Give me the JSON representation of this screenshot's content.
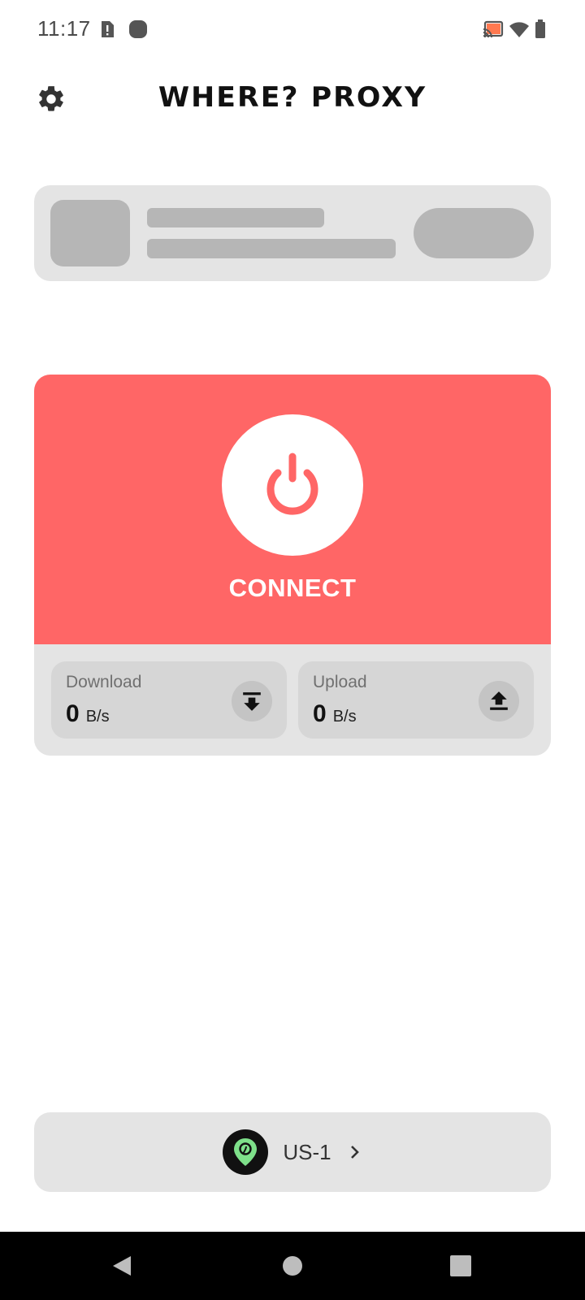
{
  "status_bar": {
    "time": "11:17",
    "icons": [
      "sim-alert-icon",
      "app-notification-icon",
      "cast-icon",
      "wifi-icon",
      "battery-icon"
    ]
  },
  "header": {
    "title": "WHERE? PROXY",
    "settings_icon": "gear-icon"
  },
  "connect_card": {
    "button_label": "CONNECT",
    "accent_color": "#ff6666",
    "download": {
      "label": "Download",
      "value": "0",
      "unit": "B/s",
      "icon": "download-icon"
    },
    "upload": {
      "label": "Upload",
      "value": "0",
      "unit": "B/s",
      "icon": "upload-icon"
    }
  },
  "server": {
    "name": "US-1",
    "icon": "location-pin-icon",
    "icon_color": "#7ee08a"
  },
  "nav_bar": {
    "buttons": [
      "back-icon",
      "home-icon",
      "recents-icon"
    ]
  }
}
